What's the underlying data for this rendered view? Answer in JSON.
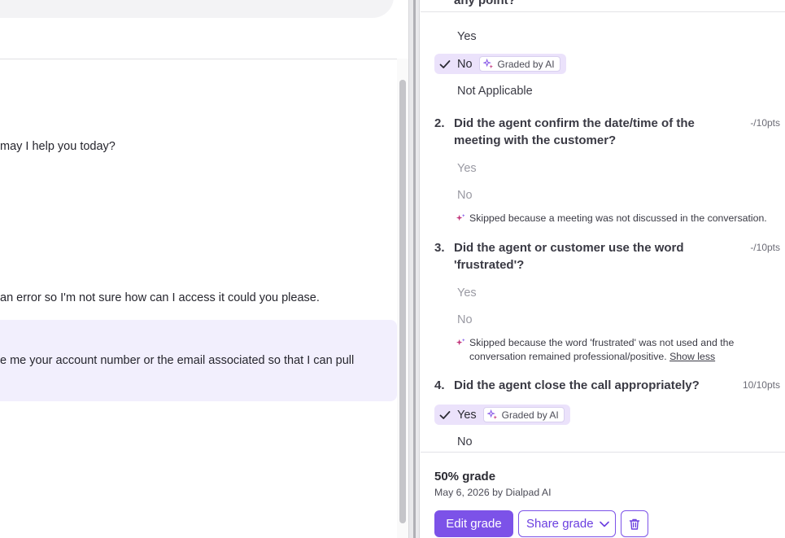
{
  "transcript": {
    "top_input_tail": "",
    "messages": [
      {
        "text": "may I help you today?"
      },
      {
        "text": "an error so I'm not sure how can I access it could you please."
      },
      {
        "text": "e me your account number or the email associated so that I can pull"
      }
    ]
  },
  "scorecard": {
    "cut_question": "any point?",
    "q1": {
      "options": {
        "yes": "Yes",
        "no": "No",
        "na": "Not Applicable"
      },
      "badge": "Graded by AI"
    },
    "q2": {
      "num": "2.",
      "text": "Did the agent confirm the date/time of the meeting with the customer?",
      "pts": "-/10pts",
      "options": {
        "yes": "Yes",
        "no": "No"
      },
      "skip_reason": "Skipped because a meeting was not discussed in the conversation."
    },
    "q3": {
      "num": "3.",
      "text": "Did the agent or customer use the word 'frustrated'?",
      "pts": "-/10pts",
      "options": {
        "yes": "Yes",
        "no": "No"
      },
      "skip_reason": "Skipped because the word 'frustrated' was not used and the conversation remained professional/positive.",
      "show_less": "Show less"
    },
    "q4": {
      "num": "4.",
      "text": "Did the agent close the call appropriately?",
      "pts": "10/10pts",
      "options": {
        "yes": "Yes",
        "no": "No"
      },
      "badge": "Graded by AI"
    }
  },
  "footer": {
    "grade_title": "50% grade",
    "grade_sub": "May 6, 2026 by Dialpad AI",
    "edit_label": "Edit grade",
    "share_label": "Share grade"
  },
  "colors": {
    "accent": "#7c52e8",
    "selected_bg": "#ebe2fb",
    "highlight_bg": "#f2effd",
    "ai_sparkle": "#c2357a"
  }
}
